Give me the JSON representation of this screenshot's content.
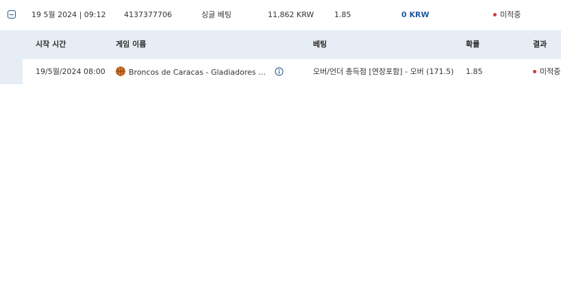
{
  "bet": {
    "date": "19 5월 2024 | 09:12",
    "id": "4137377706",
    "type": "싱글 베팅",
    "stake": "11,862 KRW",
    "odds": "1.85",
    "payout": "0 KRW",
    "status": "미적중"
  },
  "detail": {
    "headers": {
      "start_time": "시작 시간",
      "game_name": "게임 이름",
      "bet": "베팅",
      "odds": "확률",
      "result": "결과"
    },
    "rows": [
      {
        "start_time": "19/5월/2024 08:00",
        "sport_icon": "basketball-icon",
        "game_name": "Broncos de Caracas - Gladiadores de Anzoátegui",
        "bet": "오버/언더 총득점 [연장포함] - 오버 (171.5)",
        "odds": "1.85",
        "result": "미적중"
      }
    ]
  },
  "colors": {
    "accent": "#1f5aa0",
    "lost_dot": "#e0303a",
    "detail_bg": "#e7edf4",
    "basketball": "#e2782a"
  }
}
